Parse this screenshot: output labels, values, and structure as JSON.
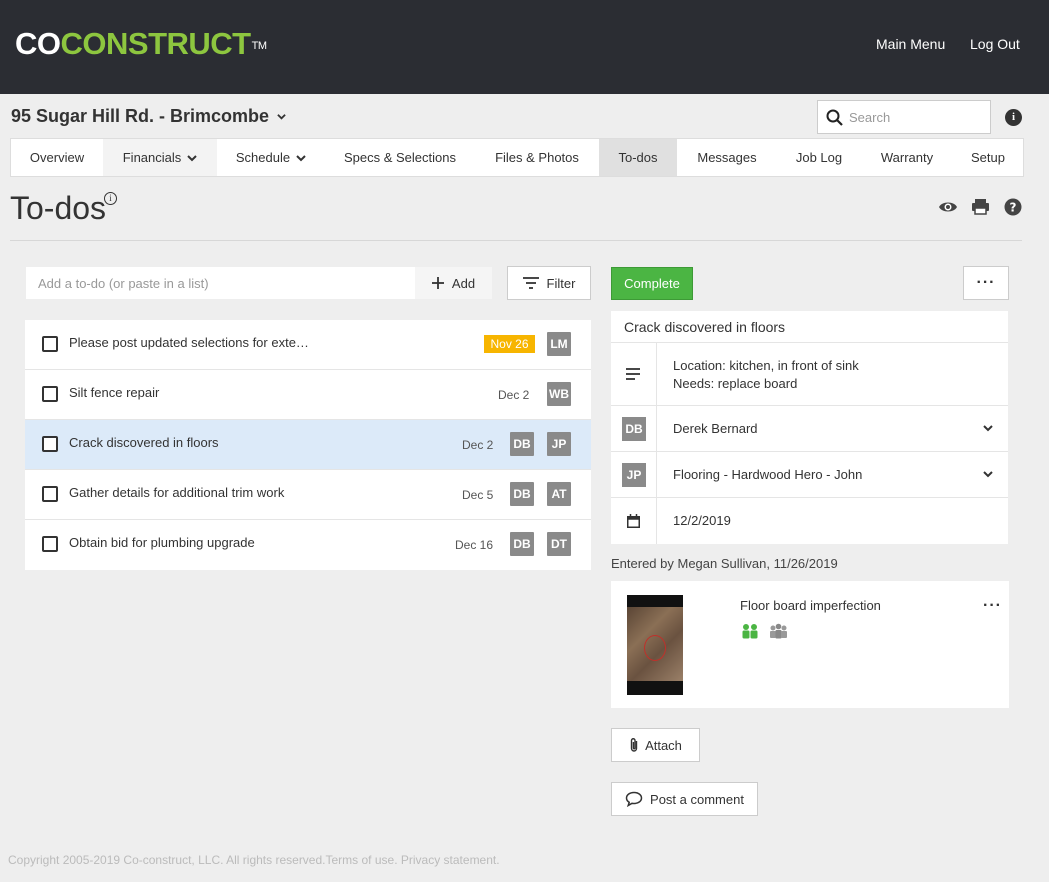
{
  "header": {
    "logo_co": "CO",
    "logo_construct": "CONSTRUCT",
    "logo_tm": "TM",
    "main_menu": "Main Menu",
    "log_out": "Log Out"
  },
  "project": {
    "name": "95 Sugar Hill Rd. - Brimcombe",
    "icon": "chevron-down-icon"
  },
  "search": {
    "placeholder": "Search",
    "value": ""
  },
  "tabs": [
    {
      "label": "Overview",
      "dropdown": false
    },
    {
      "label": "Financials",
      "dropdown": true
    },
    {
      "label": "Schedule",
      "dropdown": true
    },
    {
      "label": "Specs & Selections",
      "dropdown": false
    },
    {
      "label": "Files & Photos",
      "dropdown": false
    },
    {
      "label": "To-dos",
      "dropdown": false,
      "active": true
    },
    {
      "label": "Messages",
      "dropdown": false
    },
    {
      "label": "Job Log",
      "dropdown": false
    },
    {
      "label": "Warranty",
      "dropdown": false
    },
    {
      "label": "Setup",
      "dropdown": false
    }
  ],
  "page": {
    "title": "To-dos",
    "info_glyph": "i"
  },
  "add_todo": {
    "placeholder": "Add a to-do (or paste in a list)",
    "value": "",
    "add_label": "Add",
    "filter_label": "Filter"
  },
  "todos": [
    {
      "text": "Please post updated selections for exte…",
      "date": "Nov 26",
      "overdue": true,
      "assignees": [
        "LM"
      ]
    },
    {
      "text": "Silt fence repair",
      "date": "Dec 2",
      "overdue": false,
      "assignees": [
        "WB"
      ]
    },
    {
      "text": "Crack discovered in floors",
      "date": "Dec 2",
      "overdue": false,
      "assignees": [
        "DB",
        "JP"
      ],
      "selected": true
    },
    {
      "text": "Gather details for additional trim work",
      "date": "Dec 5",
      "overdue": false,
      "assignees": [
        "DB",
        "AT"
      ]
    },
    {
      "text": "Obtain bid for plumbing upgrade",
      "date": "Dec 16",
      "overdue": false,
      "assignees": [
        "DB",
        "DT"
      ]
    }
  ],
  "detail": {
    "complete_label": "Complete",
    "more_label": "···",
    "title": "Crack discovered in floors",
    "description_line1": "Location: kitchen, in front of sink",
    "description_line2": "Needs: replace board",
    "assignee1_initials": "DB",
    "assignee1_name": "Derek Bernard",
    "assignee2_initials": "JP",
    "assignee2_name": "Flooring - Hardwood Hero - John",
    "due_date": "12/2/2019",
    "entered_by": "Entered by Megan Sullivan, 11/26/2019"
  },
  "attachment": {
    "title": "Floor board imperfection",
    "more_label": "···"
  },
  "buttons": {
    "attach_label": "Attach",
    "comment_label": "Post a comment"
  },
  "footer": {
    "copyright": "Copyright 2005-2019 Co-construct, LLC. All rights reserved.",
    "terms": "Terms of use.",
    "privacy": "Privacy statement."
  },
  "colors": {
    "brand_green": "#8dc63f",
    "header_bg": "#2b2d33",
    "complete_green": "#4bb543",
    "overdue_badge": "#f7b500",
    "selected_row": "#dceaf9"
  }
}
